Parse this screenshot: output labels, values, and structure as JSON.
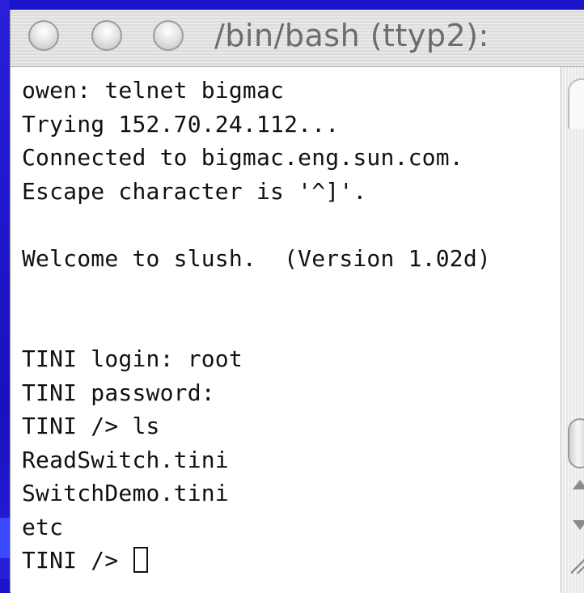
{
  "window": {
    "title": "/bin/bash (ttyp2):"
  },
  "terminal": {
    "lines": [
      "owen: telnet bigmac",
      "Trying 152.70.24.112...",
      "Connected to bigmac.eng.sun.com.",
      "Escape character is '^]'.",
      "",
      "Welcome to slush.  (Version 1.02d)",
      "",
      "",
      "TINI login: root",
      "TINI password:",
      "TINI /> ls",
      "ReadSwitch.tini",
      "SwitchDemo.tini",
      "etc",
      "TINI /> "
    ]
  },
  "colors": {
    "background": "#1c14c8",
    "window": "#ffffff",
    "text": "#111111"
  },
  "icons": {
    "close": "close-traffic-light-icon",
    "minimize": "minimize-traffic-light-icon",
    "zoom": "zoom-traffic-light-icon",
    "scroll_up": "scroll-up-arrow-icon",
    "scroll_down": "scroll-down-arrow-icon",
    "resize": "resize-grip-icon"
  }
}
